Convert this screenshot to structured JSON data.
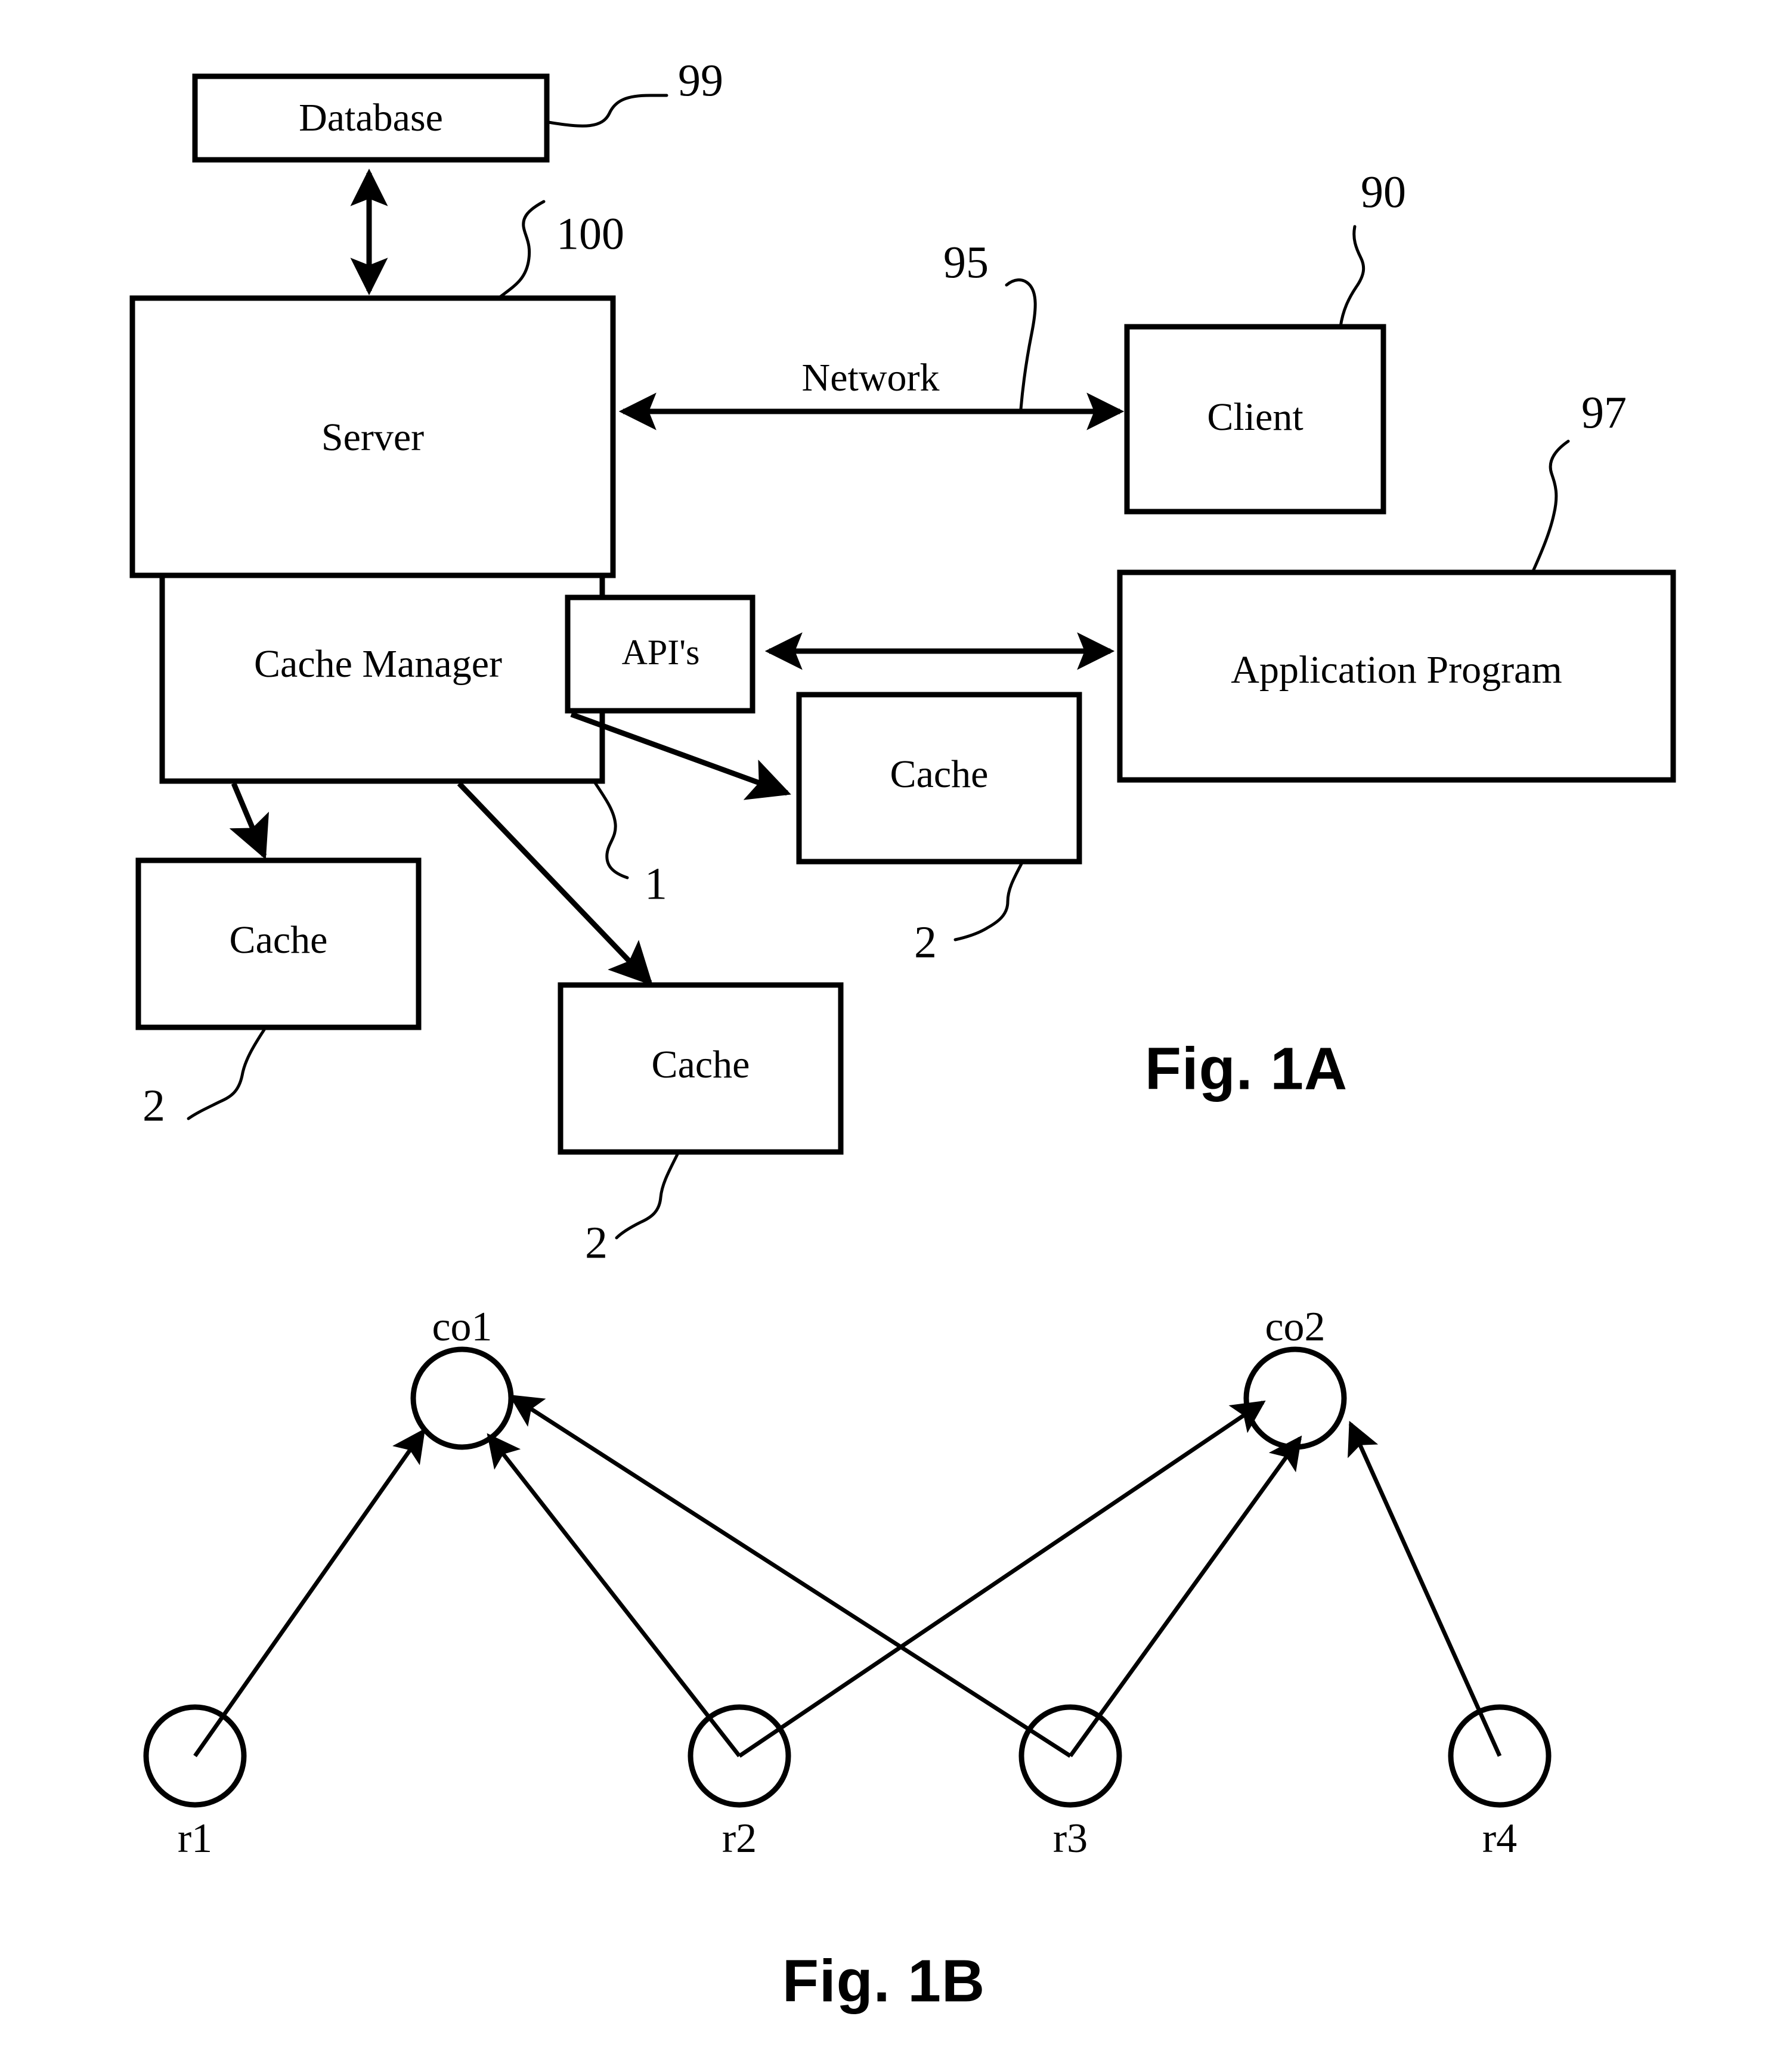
{
  "document": {
    "kind": "patent-drawing-sheet",
    "background_color": "#ffffff",
    "ink_color": "#000000"
  },
  "figures": [
    {
      "caption": "Fig. 1A",
      "type": "block-diagram",
      "blocks": [
        {
          "id": "database",
          "label": "Database",
          "ref": "99"
        },
        {
          "id": "server",
          "label": "Server",
          "ref": "100"
        },
        {
          "id": "client",
          "label": "Client",
          "ref": "90"
        },
        {
          "id": "cache-manager",
          "label": "Cache Manager",
          "ref": "1"
        },
        {
          "id": "apis",
          "label": "API's",
          "ref": ""
        },
        {
          "id": "application-program",
          "label": "Application Program",
          "ref": "97"
        },
        {
          "id": "cache-left",
          "label": "Cache",
          "ref": "2"
        },
        {
          "id": "cache-middle",
          "label": "Cache",
          "ref": "2"
        },
        {
          "id": "cache-right",
          "label": "Cache",
          "ref": "2"
        }
      ],
      "connectors": [
        {
          "from": "database",
          "to": "server",
          "label": "",
          "arrow": "both"
        },
        {
          "from": "server",
          "to": "client",
          "label": "Network",
          "ref": "95",
          "arrow": "both"
        },
        {
          "from": "apis",
          "to": "application-program",
          "label": "",
          "arrow": "both"
        },
        {
          "from": "cache-manager",
          "to": "cache-left",
          "label": "",
          "arrow": "to"
        },
        {
          "from": "cache-manager",
          "to": "cache-middle",
          "label": "",
          "arrow": "to"
        },
        {
          "from": "cache-manager",
          "to": "cache-right",
          "label": "",
          "arrow": "to"
        }
      ],
      "reference_numerals": [
        "99",
        "100",
        "95",
        "90",
        "97",
        "1",
        "2",
        "2",
        "2"
      ]
    },
    {
      "caption": "Fig. 1B",
      "type": "bipartite-graph",
      "top_nodes": [
        {
          "id": "co1",
          "label": "co1"
        },
        {
          "id": "co2",
          "label": "co2"
        }
      ],
      "bottom_nodes": [
        {
          "id": "r1",
          "label": "r1"
        },
        {
          "id": "r2",
          "label": "r2"
        },
        {
          "id": "r3",
          "label": "r3"
        },
        {
          "id": "r4",
          "label": "r4"
        }
      ],
      "edges": [
        {
          "from": "r1",
          "to": "co1"
        },
        {
          "from": "r2",
          "to": "co1"
        },
        {
          "from": "r3",
          "to": "co1"
        },
        {
          "from": "r2",
          "to": "co2"
        },
        {
          "from": "r3",
          "to": "co2"
        },
        {
          "from": "r4",
          "to": "co2"
        }
      ]
    }
  ],
  "labels": {
    "database": "Database",
    "server": "Server",
    "client": "Client",
    "cache_manager": "Cache Manager",
    "apis": "API's",
    "application_program": "Application Program",
    "cache": "Cache",
    "network": "Network",
    "fig_1a": "Fig. 1A",
    "fig_1b": "Fig. 1B",
    "co1": "co1",
    "co2": "co2",
    "r1": "r1",
    "r2": "r2",
    "r3": "r3",
    "r4": "r4"
  },
  "refs": {
    "database_ref": "99",
    "server_ref": "100",
    "network_ref": "95",
    "client_ref": "90",
    "application_ref": "97",
    "cache_manager_ref": "1",
    "cache_left_ref": "2",
    "cache_middle_ref": "2",
    "cache_right_ref": "2"
  }
}
